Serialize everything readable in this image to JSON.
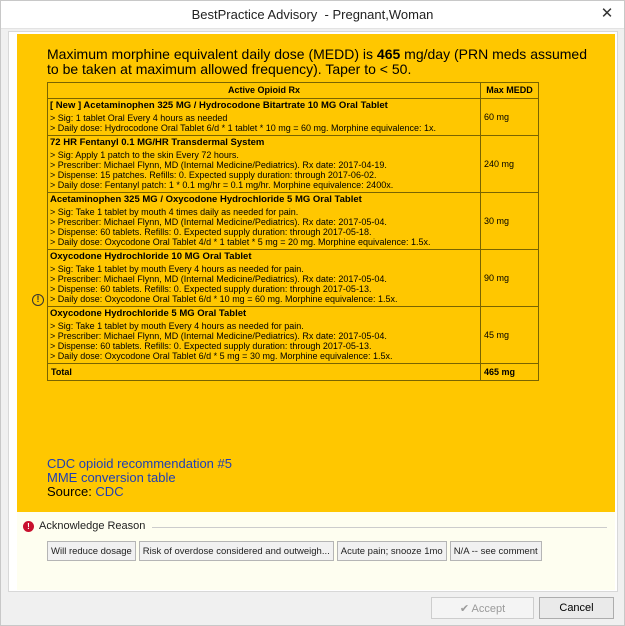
{
  "window": {
    "title": "BestPractice Advisory  - Pregnant,Woman",
    "close_glyph": "✕"
  },
  "advisory": {
    "bg_color": "#ffc700",
    "headline_prefix": "Maximum morphine equivalent daily dose (MEDD) is ",
    "headline_value": "465",
    "headline_suffix": " mg/day (PRN meds assumed to be taken at maximum allowed frequency). Taper to < 50.",
    "table_headers": [
      "Active Opioid Rx",
      "Max MEDD"
    ],
    "rows": [
      {
        "name": "[ New ] Acetaminophen 325 MG / Hydrocodone Bitartrate 10 MG Oral Tablet",
        "lines": [
          "> Sig: 1 tablet Oral Every 4 hours as needed",
          "> Daily dose: Hydrocodone Oral Tablet 6/d * 1 tablet * 10 mg = 60 mg. Morphine equivalence: 1x."
        ],
        "dose": "60 mg"
      },
      {
        "name": "72 HR Fentanyl 0.1 MG/HR Transdermal System",
        "lines": [
          "> Sig: Apply 1 patch to the skin Every 72 hours.",
          "> Prescriber: Michael Flynn, MD (Internal Medicine/Pediatrics). Rx date: 2017-04-19.",
          "> Dispense: 15 patches. Refills: 0. Expected supply duration: through 2017-06-02.",
          "> Daily dose: Fentanyl patch: 1 * 0.1 mg/hr = 0.1 mg/hr. Morphine equivalence: 2400x."
        ],
        "dose": "240 mg"
      },
      {
        "name": "Acetaminophen 325 MG / Oxycodone Hydrochloride 5 MG Oral Tablet",
        "lines": [
          "> Sig: Take 1 tablet by mouth 4 times daily as needed for pain.",
          "> Prescriber: Michael Flynn, MD (Internal Medicine/Pediatrics). Rx date: 2017-05-04.",
          "> Dispense: 60 tablets. Refills: 0. Expected supply duration: through 2017-05-18.",
          "> Daily dose: Oxycodone Oral Tablet 4/d * 1 tablet * 5 mg = 20 mg. Morphine equivalence: 1.5x."
        ],
        "dose": "30 mg"
      },
      {
        "name": "Oxycodone Hydrochloride 10 MG Oral Tablet",
        "lines": [
          "> Sig: Take 1 tablet by mouth Every 4 hours as needed for pain.",
          "> Prescriber: Michael Flynn, MD (Internal Medicine/Pediatrics). Rx date: 2017-05-04.",
          "> Dispense: 60 tablets. Refills: 0. Expected supply duration: through 2017-05-13.",
          "> Daily dose: Oxycodone Oral Tablet 6/d * 10 mg = 60 mg. Morphine equivalence: 1.5x."
        ],
        "dose": "90 mg"
      },
      {
        "name": "Oxycodone Hydrochloride 5 MG Oral Tablet",
        "lines": [
          "> Sig: Take 1 tablet by mouth Every 4 hours as needed for pain.",
          "> Prescriber: Michael Flynn, MD (Internal Medicine/Pediatrics). Rx date: 2017-05-04.",
          "> Dispense: 60 tablets. Refills: 0. Expected supply duration: through 2017-05-13.",
          "> Daily dose: Oxycodone Oral Tablet 6/d * 5 mg = 30 mg. Morphine equivalence: 1.5x."
        ],
        "dose": "45 mg"
      }
    ],
    "total_label": "Total",
    "total_value": "465 mg",
    "links": {
      "cdc_recommendation": "CDC opioid recommendation #5",
      "mme_table": "MME conversion table",
      "source_label": "Source: ",
      "source_link": "CDC"
    }
  },
  "acknowledge": {
    "title": "Acknowledge Reason",
    "reasons": [
      "Will reduce dosage",
      "Risk of overdose considered and outweigh...",
      "Acute pain; snooze 1mo",
      "N/A -- see comment"
    ]
  },
  "footer": {
    "accept_check": "✔",
    "accept_label": "Accept",
    "cancel_label": "Cancel"
  }
}
